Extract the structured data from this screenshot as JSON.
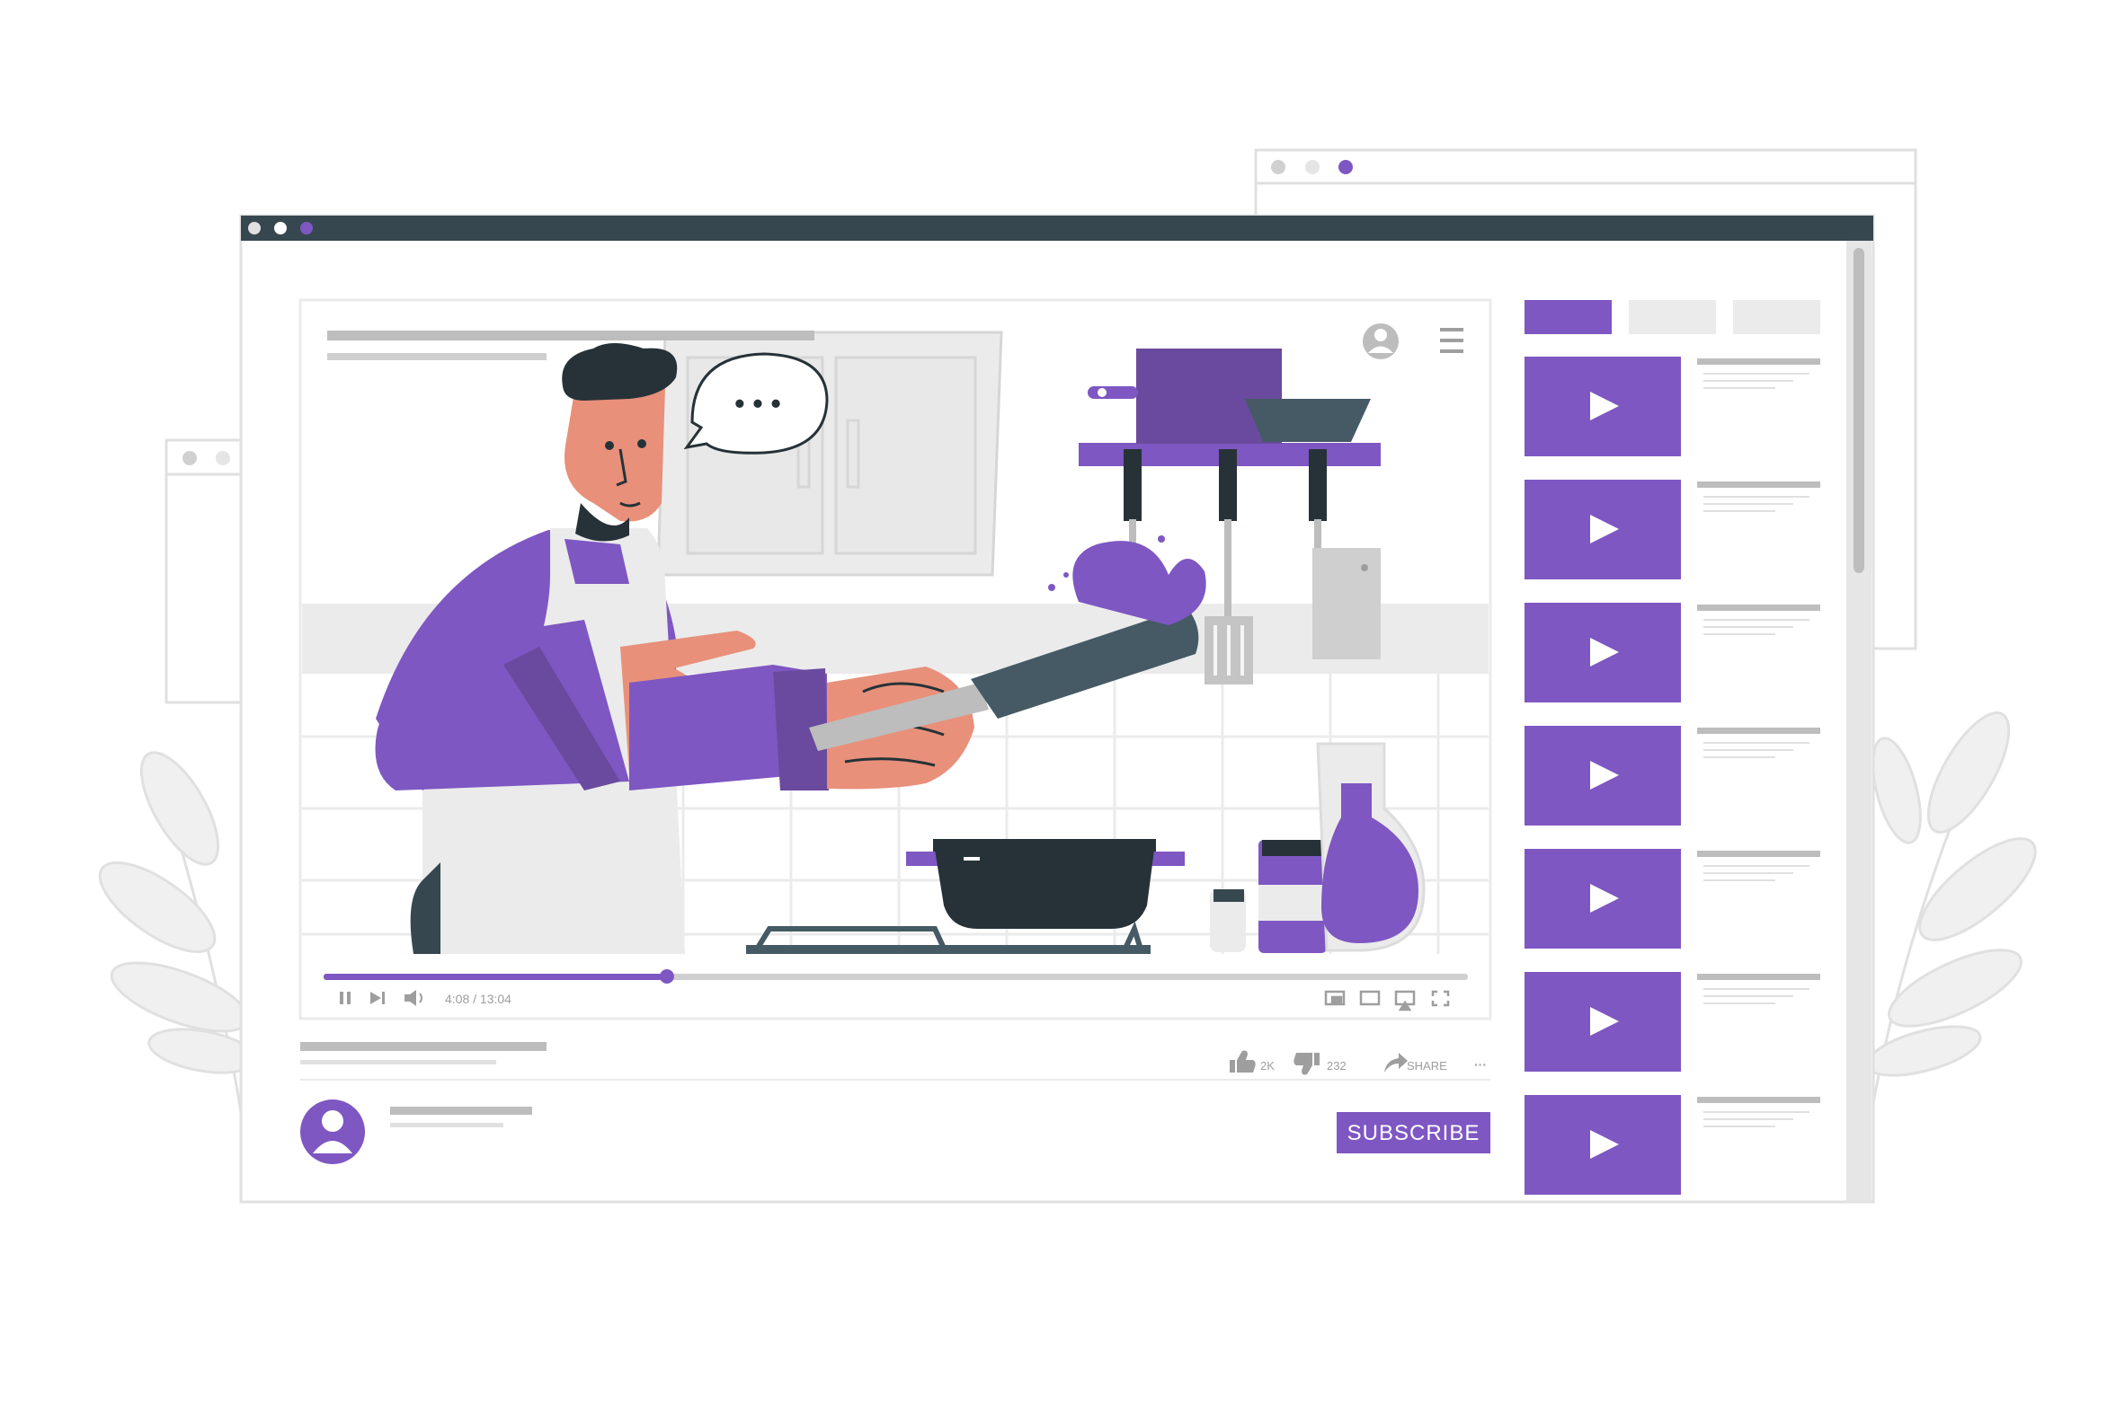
{
  "colors": {
    "accent": "#7e57c2",
    "accent_dark": "#6a4a9e",
    "chrome_bar": "#37474f",
    "dark": "#263238",
    "skin": "#e8907a",
    "apron": "#ebebeb",
    "placeholder": "#bdbdbd",
    "light_gray": "#e0e0e0"
  },
  "player": {
    "time": "4:08 / 13:04",
    "progress": 0.3,
    "speech_bubble_text": "• • •",
    "controls": [
      "pause-icon",
      "next-icon",
      "volume-icon",
      "miniplayer-icon",
      "theater-icon",
      "cast-icon",
      "fullscreen-icon"
    ]
  },
  "actions": {
    "likes": "2K",
    "dislikes": "232",
    "share_label": "SHARE",
    "more_label": "···"
  },
  "channel": {
    "subscribe_label": "SUBSCRIBE"
  },
  "sidebar": {
    "tabs": 3,
    "active_tab": 0,
    "video_count": 7
  }
}
